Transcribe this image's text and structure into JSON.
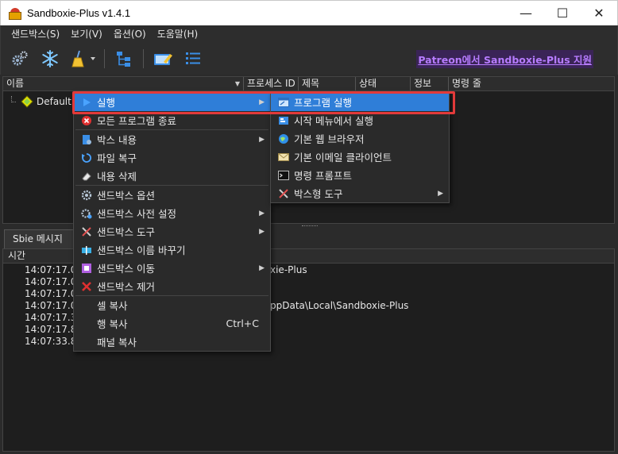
{
  "window": {
    "title": "Sandboxie-Plus v1.4.1",
    "minimize": "—",
    "maximize": "☐",
    "close": "✕"
  },
  "menubar": [
    "샌드박스(S)",
    "보기(V)",
    "옵션(O)",
    "도움말(H)"
  ],
  "toolbar": {
    "icons": [
      "gears-icon",
      "snowflake-icon",
      "broom-icon",
      "tree-view-icon",
      "edit-box-icon",
      "list-icon"
    ],
    "patreon": "Patreon에서 Sandboxie-Plus 지원"
  },
  "tree": {
    "columns": [
      "이름",
      "프로세스 ID",
      "제목",
      "상태",
      "정보",
      "명령 줄"
    ],
    "rows": [
      {
        "label": "Default"
      }
    ]
  },
  "bottom": {
    "tab": "Sbie 메시지",
    "log_header": "시간",
    "rows": [
      {
        "time": "14:07:17.07",
        "msg": "xie-Plus"
      },
      {
        "time": "14:07:17.07",
        "msg": ""
      },
      {
        "time": "14:07:17.07",
        "msg": ""
      },
      {
        "time": "14:07:17.07",
        "msg": "ppData\\Local\\Sandboxie-Plus"
      },
      {
        "time": "14:07:17.38",
        "msg": ""
      },
      {
        "time": "14:07:17.83",
        "msg": ""
      },
      {
        "time": "14:07:33.80",
        "msg": ""
      }
    ]
  },
  "context_menu": [
    {
      "label": "실행",
      "submenu": true,
      "selected": true
    },
    {
      "label": "모든 프로그램 종료",
      "separator_after": true
    },
    {
      "label": "박스 내용",
      "submenu": true
    },
    {
      "label": "파일 복구"
    },
    {
      "label": "내용 삭제",
      "separator_after": true
    },
    {
      "label": "샌드박스 옵션"
    },
    {
      "label": "샌드박스 사전 설정",
      "submenu": true
    },
    {
      "label": "샌드박스 도구",
      "submenu": true
    },
    {
      "label": "샌드박스 이름 바꾸기"
    },
    {
      "label": "샌드박스 이동",
      "submenu": true
    },
    {
      "label": "샌드박스 제거",
      "separator_after": true
    },
    {
      "label": "셀 복사"
    },
    {
      "label": "행 복사",
      "shortcut": "Ctrl+C"
    },
    {
      "label": "패널 복사"
    }
  ],
  "run_submenu": [
    {
      "label": "프로그램 실행",
      "selected": true
    },
    {
      "label": "시작 메뉴에서 실행"
    },
    {
      "label": "기본 웹 브라우저"
    },
    {
      "label": "기본 이메일 클라이언트"
    },
    {
      "label": "명령 프롬프트"
    },
    {
      "label": "박스형 도구",
      "submenu": true
    }
  ],
  "colors": {
    "selection": "#2f7ed8",
    "highlight_box": "#e23a3a",
    "patreon": "#b77cff",
    "background": "#1e1e1e"
  }
}
